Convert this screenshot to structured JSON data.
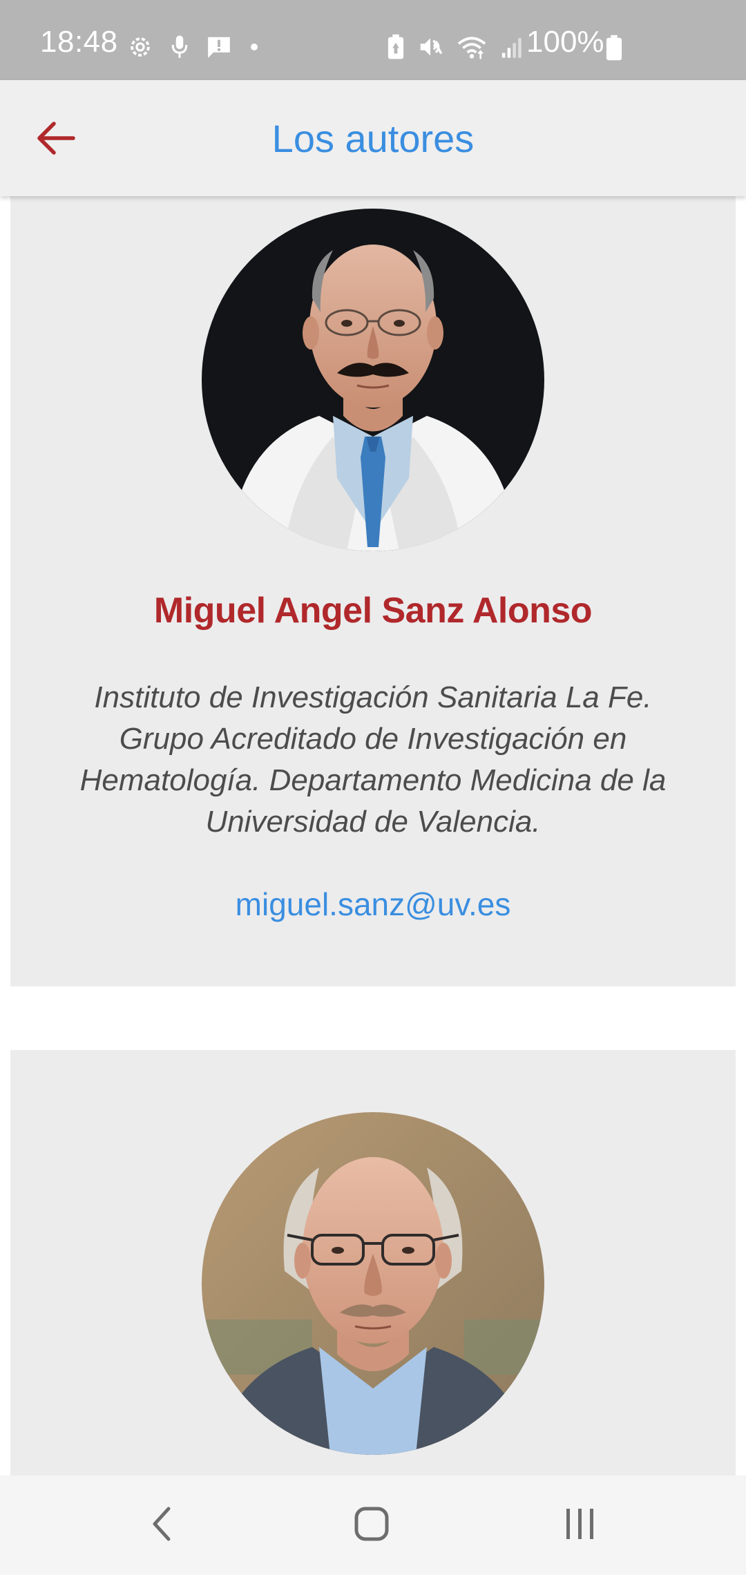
{
  "status_bar": {
    "time": "18:48",
    "battery_percent": "100%",
    "icons_left": [
      "gear-icon",
      "mic-icon",
      "alert-message-icon",
      "dot-icon"
    ],
    "icons_right": [
      "battery-saver-icon",
      "mute-icon",
      "wifi-icon",
      "signal-icon",
      "battery-icon"
    ]
  },
  "app_bar": {
    "title": "Los autores",
    "back_icon": "arrow-left-icon"
  },
  "authors": [
    {
      "name": "Miguel Angel Sanz Alonso",
      "affiliation": "Instituto de Investigación Sanitaria La Fe. Grupo Acreditado de Investigación en Hematología. Departamento Medicina de la Universidad de Valencia.",
      "email": "miguel.sanz@uv.es",
      "photo": "author-photo"
    },
    {
      "name": "",
      "affiliation": "",
      "email": "",
      "photo": "author-photo"
    }
  ],
  "nav_bar": {
    "icons": [
      "back-nav-icon",
      "home-nav-icon",
      "recents-nav-icon"
    ]
  },
  "colors": {
    "accent_blue": "#3a8ee0",
    "name_red": "#b0282b",
    "back_arrow_red": "#b0282b",
    "status_bar_bg": "#b5b5b5",
    "app_bar_bg": "#efefef",
    "card_bg": "#ececed"
  }
}
